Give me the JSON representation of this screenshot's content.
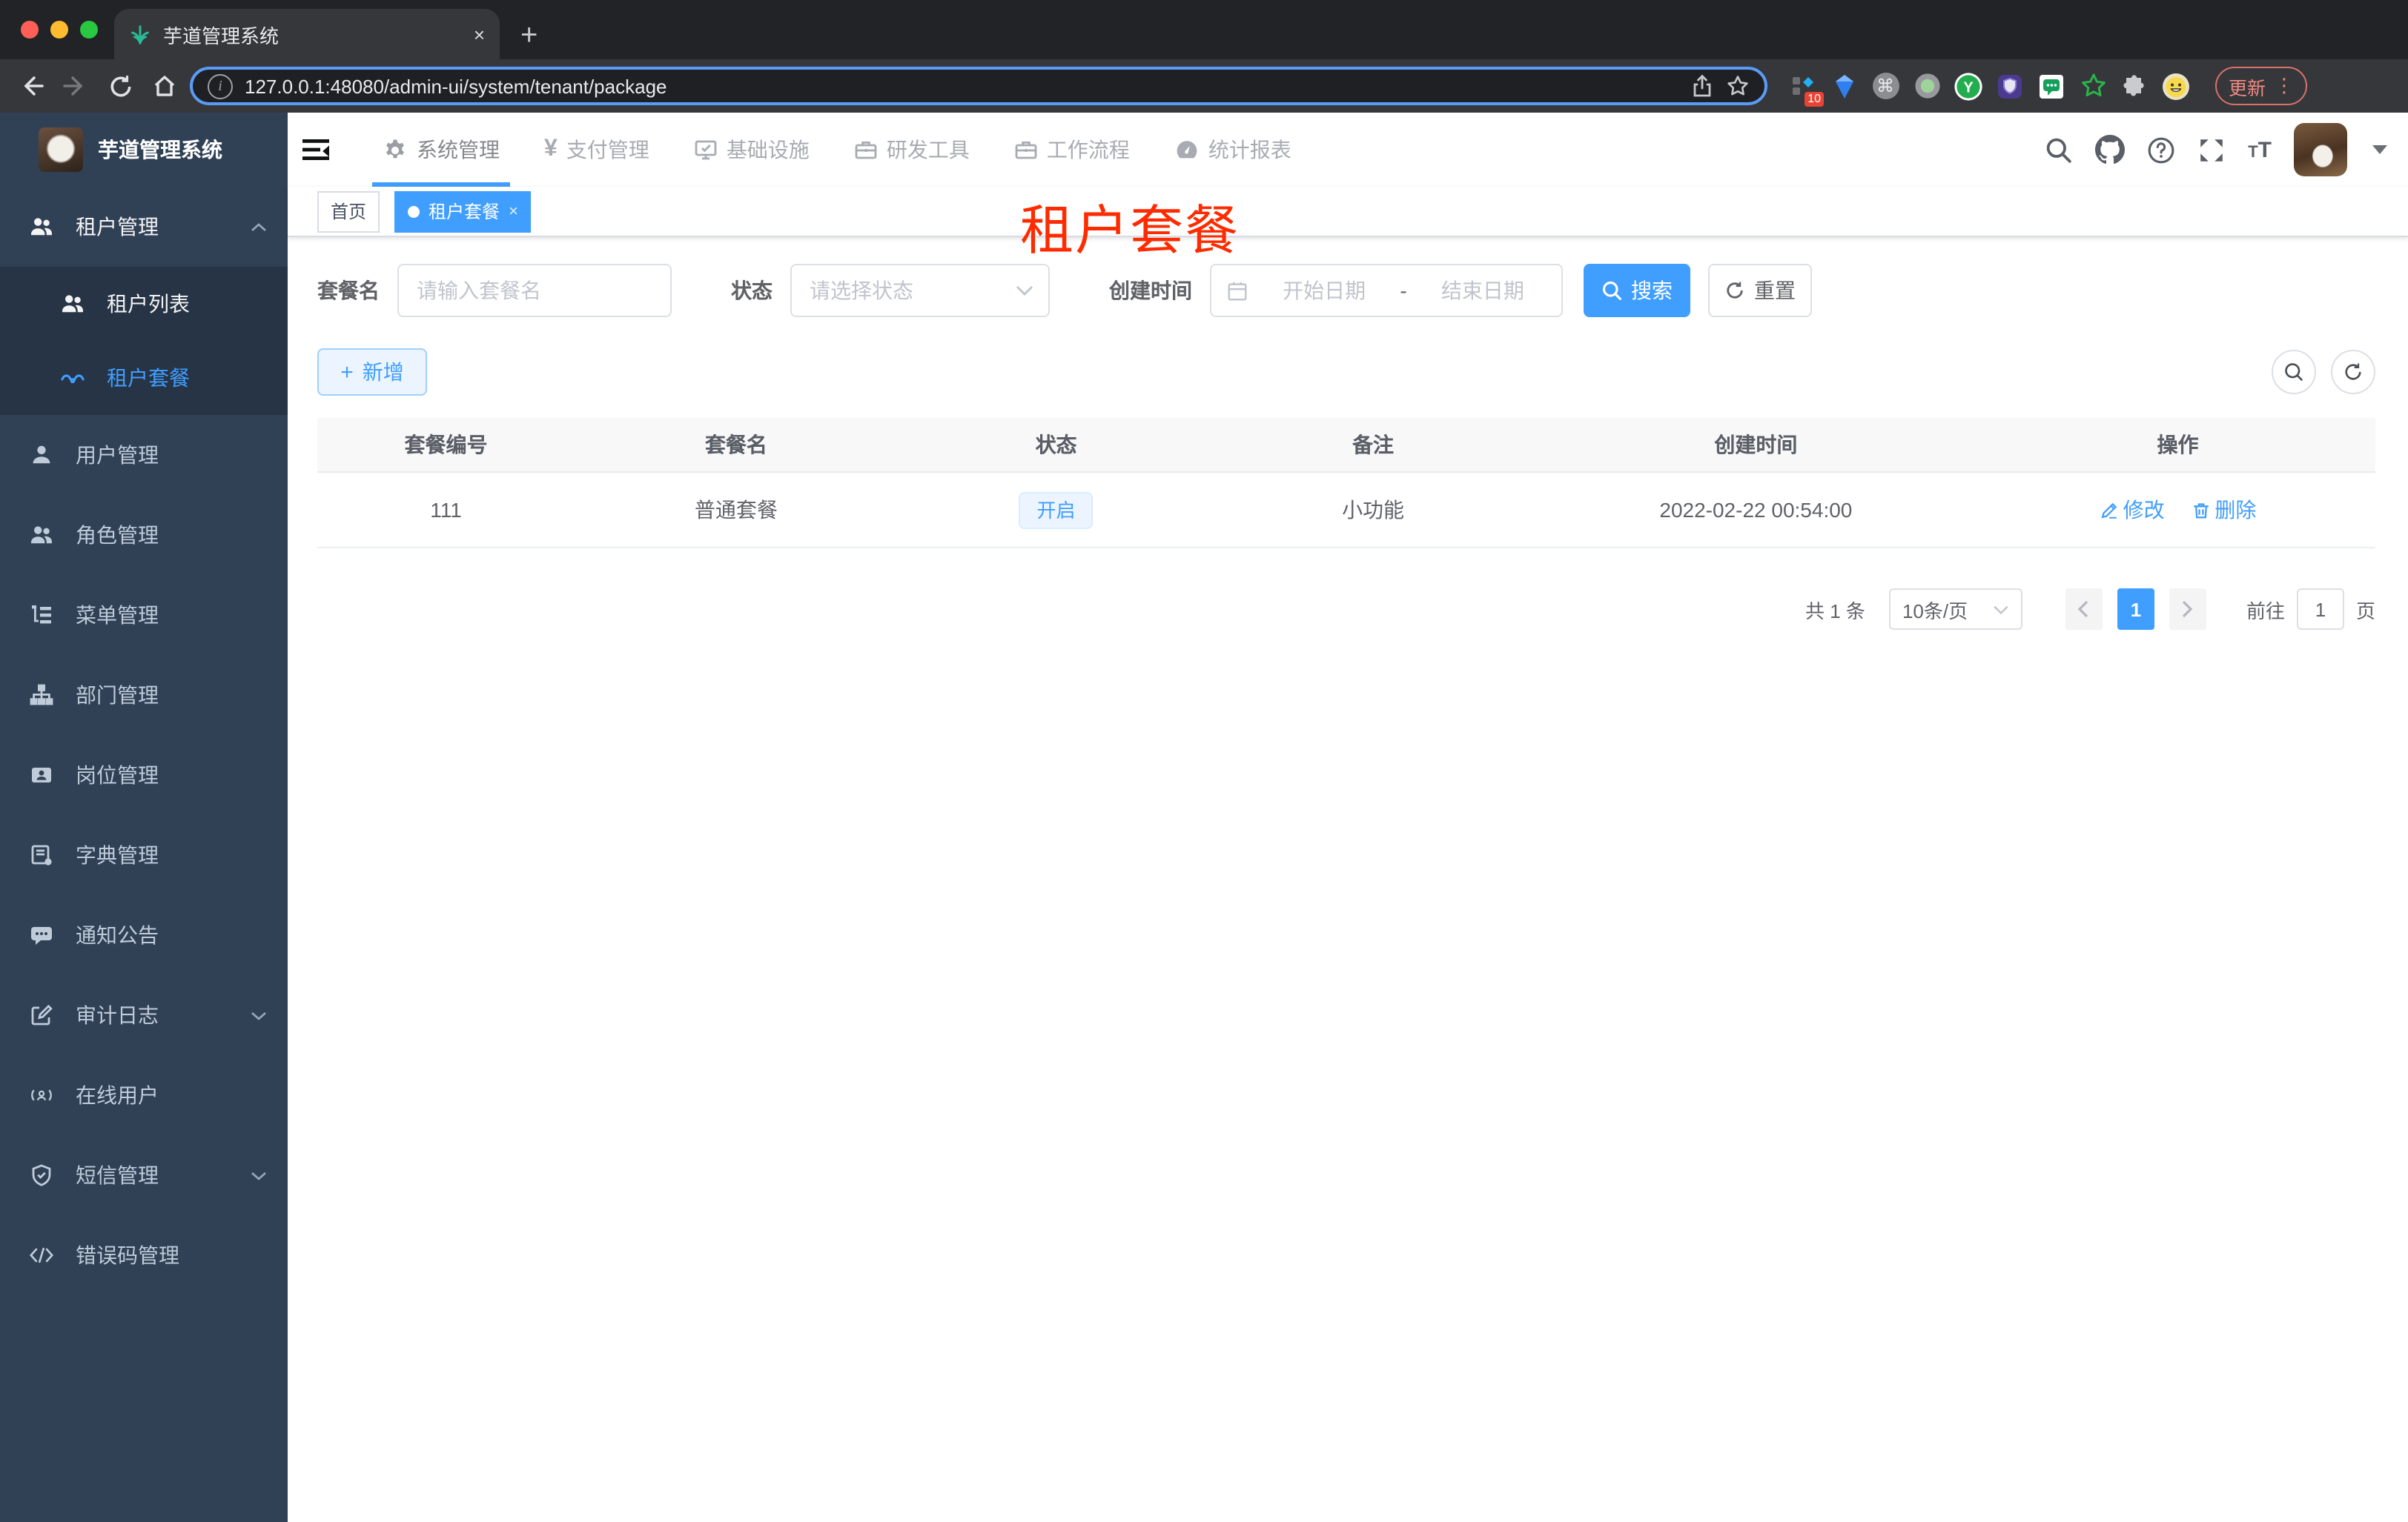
{
  "browser": {
    "tab_title": "芋道管理系统",
    "tab_close": "×",
    "new_tab": "+",
    "url": "127.0.0.1:48080/admin-ui/system/tenant/package",
    "extension_badge": "10",
    "update_label": "更新",
    "icons": [
      "back-icon",
      "forward-icon",
      "reload-icon",
      "home-icon",
      "info-icon",
      "share-icon",
      "bookmark-star-icon",
      "extensions-puzzle-icon",
      "profile-smiley-icon",
      "kebab-menu-icon"
    ]
  },
  "overlay": {
    "title": "租户套餐",
    "color": "#ff2b00"
  },
  "sidebar": {
    "logo_title": "芋道管理系统",
    "items": [
      {
        "label": "租户管理",
        "icon": "users-icon",
        "expanded": true
      },
      {
        "label": "租户列表",
        "icon": "users-icon"
      },
      {
        "label": "租户套餐",
        "icon": "glasses-icon",
        "active": true
      },
      {
        "label": "用户管理",
        "icon": "user-icon"
      },
      {
        "label": "角色管理",
        "icon": "users-icon"
      },
      {
        "label": "菜单管理",
        "icon": "tree-list-icon"
      },
      {
        "label": "部门管理",
        "icon": "sitemap-icon"
      },
      {
        "label": "岗位管理",
        "icon": "badge-icon"
      },
      {
        "label": "字典管理",
        "icon": "dictionary-icon"
      },
      {
        "label": "通知公告",
        "icon": "message-icon"
      },
      {
        "label": "审计日志",
        "icon": "log-edit-icon",
        "expandable": true
      },
      {
        "label": "在线用户",
        "icon": "online-icon"
      },
      {
        "label": "短信管理",
        "icon": "shield-icon",
        "expandable": true
      },
      {
        "label": "错误码管理",
        "icon": "code-icon"
      }
    ]
  },
  "topnav": {
    "items": [
      {
        "label": "系统管理",
        "icon": "gear-icon",
        "active": true
      },
      {
        "label": "支付管理",
        "icon": "yen-icon"
      },
      {
        "label": "基础设施",
        "icon": "monitor-icon"
      },
      {
        "label": "研发工具",
        "icon": "toolbox-icon"
      },
      {
        "label": "工作流程",
        "icon": "toolbox-icon"
      },
      {
        "label": "统计报表",
        "icon": "dashboard-icon"
      }
    ],
    "right_icons": [
      "search-icon",
      "github-icon",
      "help-icon",
      "fullscreen-icon",
      "text-size-icon",
      "avatar",
      "dropdown-caret-icon"
    ]
  },
  "tags_view": {
    "items": [
      {
        "label": "首页"
      },
      {
        "label": "租户套餐",
        "active": true,
        "close": "×"
      }
    ]
  },
  "search_form": {
    "name_label": "套餐名",
    "name_placeholder": "请输入套餐名",
    "status_label": "状态",
    "status_placeholder": "请选择状态",
    "date_label": "创建时间",
    "date_start_placeholder": "开始日期",
    "date_separator": "-",
    "date_end_placeholder": "结束日期",
    "search_label": "搜索",
    "reset_label": "重置"
  },
  "toolbar": {
    "add_label": "新增"
  },
  "table": {
    "columns": [
      "套餐编号",
      "套餐名",
      "状态",
      "备注",
      "创建时间",
      "操作"
    ],
    "rows": [
      {
        "id": "111",
        "name": "普通套餐",
        "status": "开启",
        "remark": "小功能",
        "created_at": "2022-02-22 00:54:00",
        "actions": {
          "edit": "修改",
          "delete": "删除"
        }
      }
    ]
  },
  "pagination": {
    "total": "共 1 条",
    "page_size": "10条/页",
    "current": "1",
    "goto_prefix": "前往",
    "goto_value": "1",
    "goto_suffix": "页"
  },
  "colors": {
    "accent": "#409eff",
    "sidebar_bg": "#304156",
    "submenu_bg": "#263445",
    "red_overlay": "#ff2b00",
    "status_tag_bg": "#ecf5ff"
  }
}
